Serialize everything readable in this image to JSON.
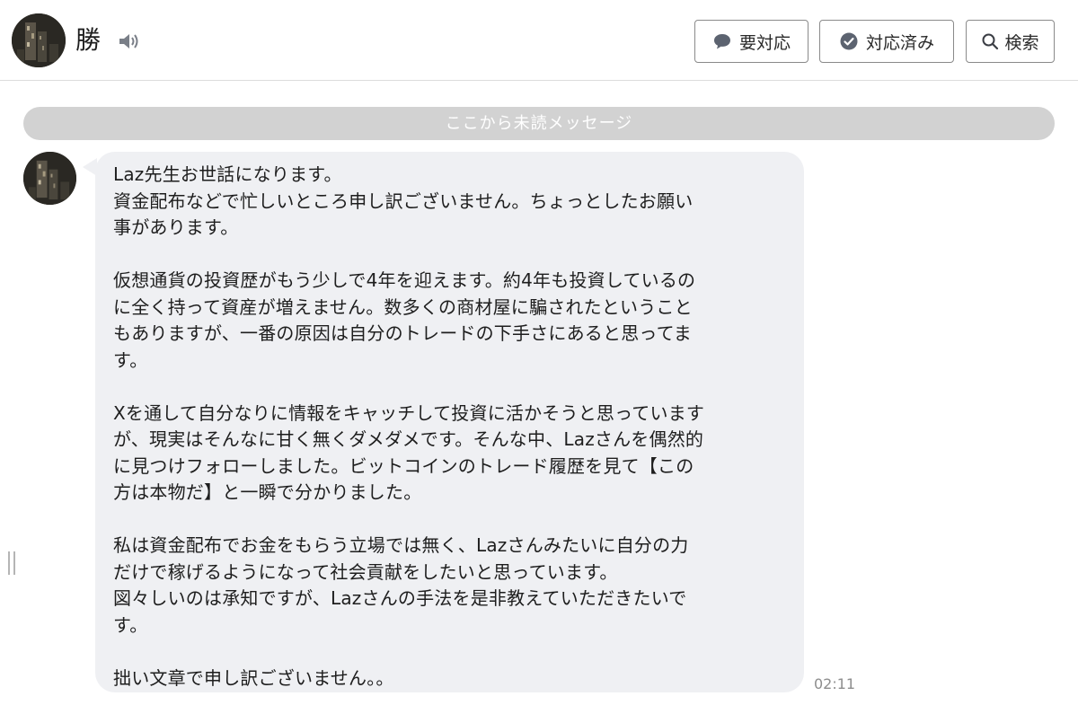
{
  "header": {
    "contact_name": "勝",
    "buttons": {
      "needs_response": "要対応",
      "responded": "対応済み",
      "search": "検索"
    }
  },
  "chat": {
    "unread_divider": "ここから未読メッセージ",
    "message": {
      "text": "Laz先生お世話になります。\n資金配布などで忙しいところ申し訳ございません。ちょっとしたお願い\n事があります。\n\n仮想通貨の投資歴がもう少しで4年を迎えます。約4年も投資しているの\nに全く持って資産が増えません。数多くの商材屋に騙されたということ\nもありますが、一番の原因は自分のトレードの下手さにあると思ってま\nす。\n\nXを通して自分なりに情報をキャッチして投資に活かそうと思っています\nが、現実はそんなに甘く無くダメダメです。そんな中、Lazさんを偶然的\nに見つけフォローしました。ビットコインのトレード履歴を見て【この\n方は本物だ】と一瞬で分かりました。\n\n私は資金配布でお金をもらう立場では無く、Lazさんみたいに自分の力\nだけで稼げるようになって社会貢献をしたいと思っています。\n図々しいのは承知ですが、Lazさんの手法を是非教えていただきたいで\nす。\n\n拙い文章で申し訳ございません。。",
      "time": "02:11"
    }
  },
  "colors": {
    "bubble": "#eff0f3",
    "divider": "#d2d2d2",
    "border": "#8a8a8a"
  },
  "icons": {
    "speaker": "speaker-icon",
    "needs_response": "speech-bubble-icon",
    "responded": "check-circle-icon",
    "search": "search-icon"
  }
}
